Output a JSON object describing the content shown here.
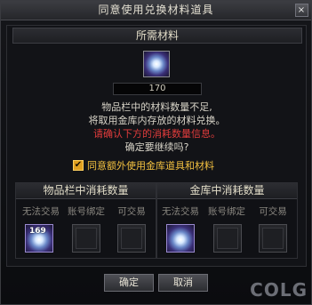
{
  "dialog": {
    "title": "同意使用兑换材料道具",
    "close_symbol": "×"
  },
  "required": {
    "header": "所需材料",
    "item_icon": "crystal-orb-icon",
    "quantity": "170"
  },
  "messages": {
    "line1": "物品栏中的材料数量不足,",
    "line2": "将取用金库内存放的材料兑换。",
    "line3": "请确认下方的消耗数量信息。",
    "line4": "确定要继续吗?"
  },
  "agree": {
    "checked": true,
    "check_symbol": "✔",
    "label": "同意额外使用金库道具和材料"
  },
  "inventory_box": {
    "header": "物品栏中消耗数量",
    "columns": [
      "无法交易",
      "账号绑定",
      "可交易"
    ],
    "slots": [
      {
        "filled": true,
        "count": "169"
      },
      {
        "filled": false,
        "count": ""
      },
      {
        "filled": false,
        "count": ""
      }
    ]
  },
  "vault_box": {
    "header": "金库中消耗数量",
    "columns": [
      "无法交易",
      "账号绑定",
      "可交易"
    ],
    "slots": [
      {
        "filled": true,
        "count": ""
      },
      {
        "filled": false,
        "count": ""
      },
      {
        "filled": false,
        "count": ""
      }
    ]
  },
  "buttons": {
    "confirm": "确定",
    "cancel": "取消"
  },
  "watermark": "COLG",
  "colors": {
    "warning_text": "#e23c3c",
    "agree_text": "#f2c040"
  }
}
